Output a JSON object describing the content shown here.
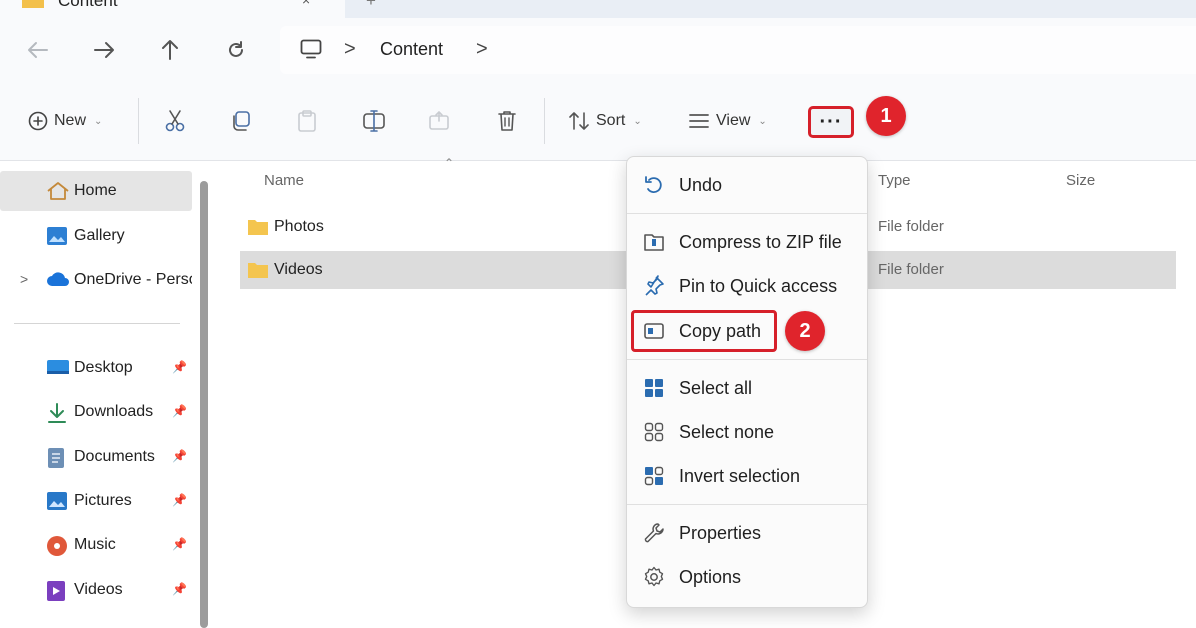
{
  "window": {
    "tab_title": "Content",
    "tab_close": "×",
    "tab_add": "+"
  },
  "nav": {
    "back_icon": "arrow-left-icon",
    "forward_icon": "arrow-right-icon",
    "up_icon": "arrow-up-icon",
    "refresh_icon": "refresh-icon"
  },
  "address": {
    "separator": ">",
    "crumbs": [
      "Content"
    ]
  },
  "toolbar": {
    "new_label": "New",
    "sort_label": "Sort",
    "view_label": "View",
    "more_label": "···",
    "caret": "⌄"
  },
  "annotations": {
    "step1": "1",
    "step2": "2",
    "accent": "#e0242c"
  },
  "sidebar": {
    "items": [
      {
        "label": "Home",
        "icon": "home-icon"
      },
      {
        "label": "Gallery",
        "icon": "gallery-icon"
      },
      {
        "label": "OneDrive - Perso",
        "icon": "cloud-icon"
      },
      {
        "label": "Desktop",
        "icon": "desktop-icon"
      },
      {
        "label": "Downloads",
        "icon": "download-icon"
      },
      {
        "label": "Documents",
        "icon": "documents-icon"
      },
      {
        "label": "Pictures",
        "icon": "pictures-icon"
      },
      {
        "label": "Music",
        "icon": "music-icon"
      },
      {
        "label": "Videos",
        "icon": "videos-icon"
      }
    ],
    "expand_glyph": ">"
  },
  "files": {
    "columns": [
      "Name",
      "Type",
      "Size"
    ],
    "rows": [
      {
        "name": "Photos",
        "type": "File folder"
      },
      {
        "name": "Videos",
        "type": "File folder"
      }
    ]
  },
  "context_menu": {
    "items": [
      {
        "label": "Undo",
        "icon": "undo-icon"
      },
      {
        "label": "Compress to ZIP file",
        "icon": "zip-icon"
      },
      {
        "label": "Pin to Quick access",
        "icon": "pin-icon"
      },
      {
        "label": "Copy path",
        "icon": "copy-path-icon"
      },
      {
        "label": "Select all",
        "icon": "select-all-icon"
      },
      {
        "label": "Select none",
        "icon": "select-none-icon"
      },
      {
        "label": "Invert selection",
        "icon": "invert-selection-icon"
      },
      {
        "label": "Properties",
        "icon": "properties-icon"
      },
      {
        "label": "Options",
        "icon": "options-icon"
      }
    ]
  }
}
